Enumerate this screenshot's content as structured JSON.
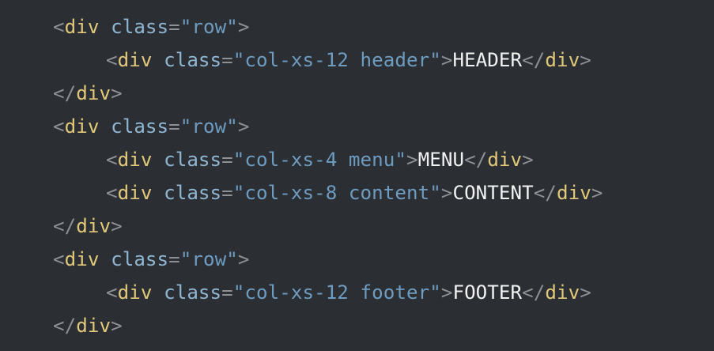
{
  "code_lines": [
    {
      "type": "open",
      "indent": 1,
      "tag": "div",
      "attr": "class",
      "value": "row"
    },
    {
      "type": "inline",
      "indent": 2,
      "tag": "div",
      "attr": "class",
      "value": "col-xs-12 header",
      "text": "HEADER"
    },
    {
      "type": "close",
      "indent": 1,
      "tag": "div"
    },
    {
      "type": "open",
      "indent": 1,
      "tag": "div",
      "attr": "class",
      "value": "row"
    },
    {
      "type": "inline",
      "indent": 2,
      "tag": "div",
      "attr": "class",
      "value": "col-xs-4 menu",
      "text": "MENU"
    },
    {
      "type": "inline",
      "indent": 2,
      "tag": "div",
      "attr": "class",
      "value": "col-xs-8 content",
      "text": "CONTENT"
    },
    {
      "type": "close",
      "indent": 1,
      "tag": "div"
    },
    {
      "type": "open",
      "indent": 1,
      "tag": "div",
      "attr": "class",
      "value": "row"
    },
    {
      "type": "inline",
      "indent": 2,
      "tag": "div",
      "attr": "class",
      "value": "col-xs-12 footer",
      "text": "FOOTER"
    },
    {
      "type": "close",
      "indent": 1,
      "tag": "div"
    }
  ],
  "colors": {
    "background": "#2b2f34",
    "punctuation": "#8e9095",
    "tag": "#e2c97a",
    "attribute": "#8fb6d2",
    "string": "#6e9cc0",
    "text": "#f2f2f2"
  }
}
